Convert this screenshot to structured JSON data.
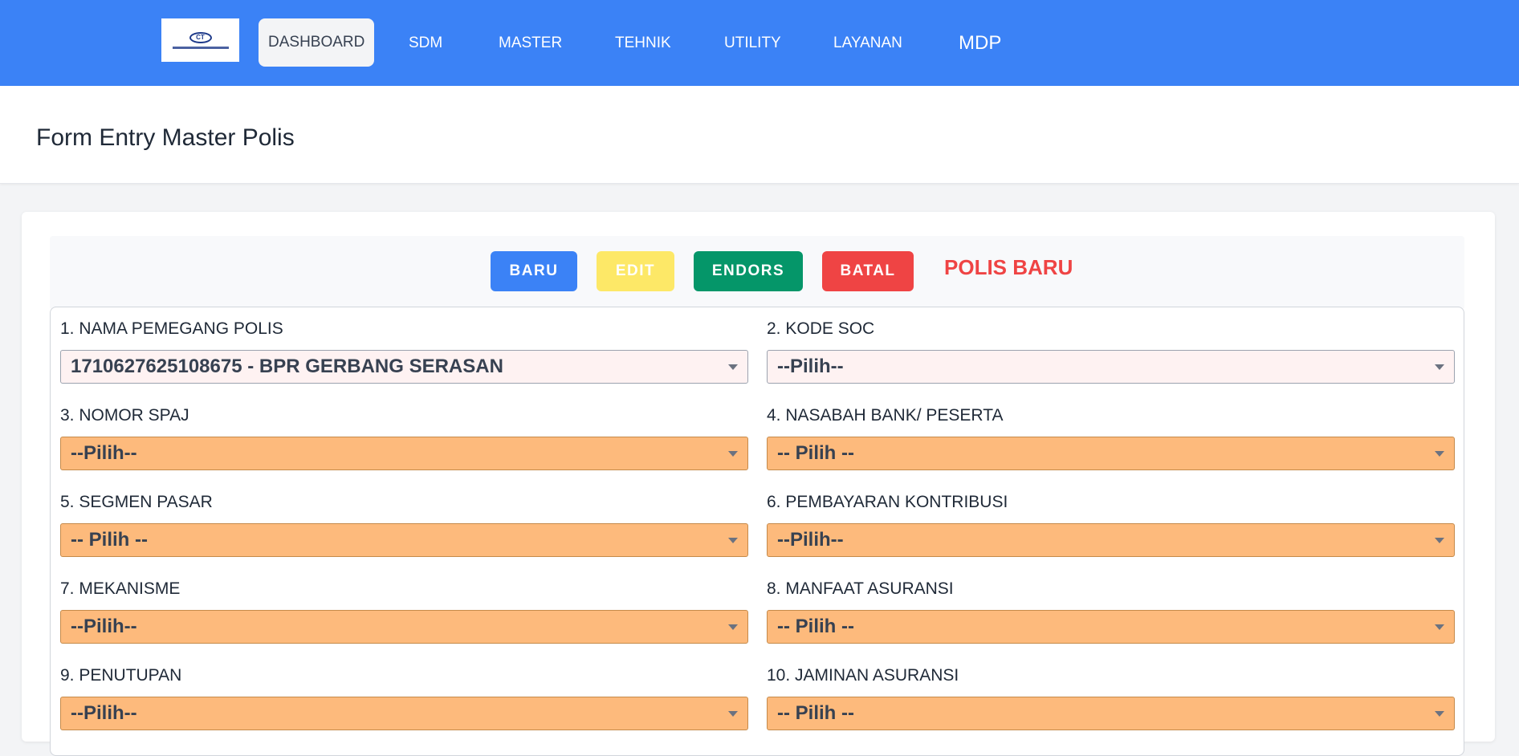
{
  "nav": {
    "items": [
      {
        "label": "DASHBOARD"
      },
      {
        "label": "SDM"
      },
      {
        "label": "MASTER"
      },
      {
        "label": "TEHNIK"
      },
      {
        "label": "UTILITY"
      },
      {
        "label": "LAYANAN"
      },
      {
        "label": "MDP"
      }
    ]
  },
  "page": {
    "title": "Form Entry Master Polis"
  },
  "toolbar": {
    "baru_label": "BARU",
    "edit_label": "EDIT",
    "endors_label": "ENDORS",
    "batal_label": "BATAL",
    "status_text": "POLIS BARU"
  },
  "form": {
    "fields": [
      {
        "label": "1. NAMA PEMEGANG POLIS",
        "value": "1710627625108675 - BPR GERBANG SERASAN"
      },
      {
        "label": "2. KODE SOC",
        "value": "--Pilih--"
      },
      {
        "label": "3. NOMOR SPAJ",
        "value": "--Pilih--"
      },
      {
        "label": "4. NASABAH BANK/ PESERTA",
        "value": "-- Pilih --"
      },
      {
        "label": "5. SEGMEN PASAR",
        "value": "-- Pilih --"
      },
      {
        "label": "6. PEMBAYARAN KONTRIBUSI",
        "value": "--Pilih--"
      },
      {
        "label": "7. MEKANISME",
        "value": "--Pilih--"
      },
      {
        "label": "8. MANFAAT ASURANSI",
        "value": "-- Pilih --"
      },
      {
        "label": "9. PENUTUPAN",
        "value": "--Pilih--"
      },
      {
        "label": "10. JAMINAN ASURANSI",
        "value": "-- Pilih --"
      }
    ]
  },
  "colors": {
    "nav_bg": "#3b82f6",
    "select_orange": "#fdba7c",
    "select_pink": "#fef2f2",
    "btn_baru": "#3b82f6",
    "btn_edit": "#fde867",
    "btn_endors": "#059669",
    "btn_batal": "#ef4444",
    "status_red": "#ef4444"
  }
}
